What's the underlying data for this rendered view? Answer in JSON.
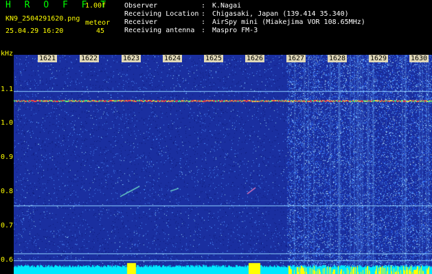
{
  "header": {
    "app_title": "H R O F F T",
    "version": "1.00f",
    "filename": "KN9_2504291620.png",
    "meteor_label": "meteor",
    "datetime": "25.04.29 16:20",
    "meteor_count": "45"
  },
  "info": [
    {
      "label": "Observer",
      "value": "K.Nagai"
    },
    {
      "label": "Receiving Location",
      "value": "Chigasaki, Japan (139.414 35.340)"
    },
    {
      "label": "Receiver",
      "value": "AirSpy mini (Miakejima VOR 108.65MHz)"
    },
    {
      "label": "Receiving antenna",
      "value": "Maspro FM-3"
    }
  ],
  "axis": {
    "y_unit": "kHz",
    "y_ticks": [
      "1.1",
      "1.0",
      "0.9",
      "0.8",
      "0.7",
      "0.6"
    ],
    "x_ticks": [
      "1621",
      "1622",
      "1623",
      "1624",
      "1625",
      "1626",
      "1627",
      "1628",
      "1629",
      "1630"
    ]
  },
  "colors": {
    "background": "#1a2fa0",
    "noise_dark": "#0c1a78",
    "noise_light": "#4a8cff",
    "carrier": "#ff4040",
    "horizontal_line": "#8fd0ff",
    "bottom_bar": "#00e8ff",
    "bottom_bar_peak": "#ffff00",
    "label_yellow": "#ffff00",
    "title_green": "#00ff00"
  }
}
